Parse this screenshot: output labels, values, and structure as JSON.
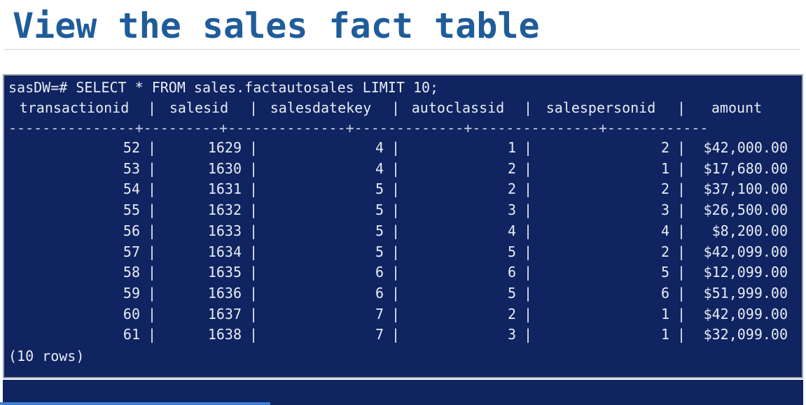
{
  "title": "View the sales fact table",
  "terminal": {
    "command": "sasDW=# SELECT * FROM sales.factautosales LIMIT 10;",
    "columns": [
      "transactionid",
      "salesid",
      "salesdatekey",
      "autoclassid",
      "salespersonid",
      "amount"
    ],
    "separator": "---------------+---------+--------------+-------------+---------------+------------",
    "rows": [
      [
        "52",
        "1629",
        "4",
        "1",
        "2",
        "$42,000.00"
      ],
      [
        "53",
        "1630",
        "4",
        "2",
        "1",
        "$17,680.00"
      ],
      [
        "54",
        "1631",
        "5",
        "2",
        "2",
        "$37,100.00"
      ],
      [
        "55",
        "1632",
        "5",
        "3",
        "3",
        "$26,500.00"
      ],
      [
        "56",
        "1633",
        "5",
        "4",
        "4",
        "$8,200.00"
      ],
      [
        "57",
        "1634",
        "5",
        "5",
        "2",
        "$42,099.00"
      ],
      [
        "58",
        "1635",
        "6",
        "6",
        "5",
        "$12,099.00"
      ],
      [
        "59",
        "1636",
        "6",
        "5",
        "6",
        "$51,999.00"
      ],
      [
        "60",
        "1637",
        "7",
        "2",
        "1",
        "$42,099.00"
      ],
      [
        "61",
        "1638",
        "7",
        "3",
        "1",
        "$32,099.00"
      ]
    ],
    "footer": "(10 rows)"
  },
  "video": {
    "progress_fraction": 0.335,
    "progress_color": "#3d7fd6"
  },
  "colors": {
    "title": "#1f5c99",
    "terminal_bg": "#0f2460",
    "terminal_text": "#e8ecf5"
  }
}
